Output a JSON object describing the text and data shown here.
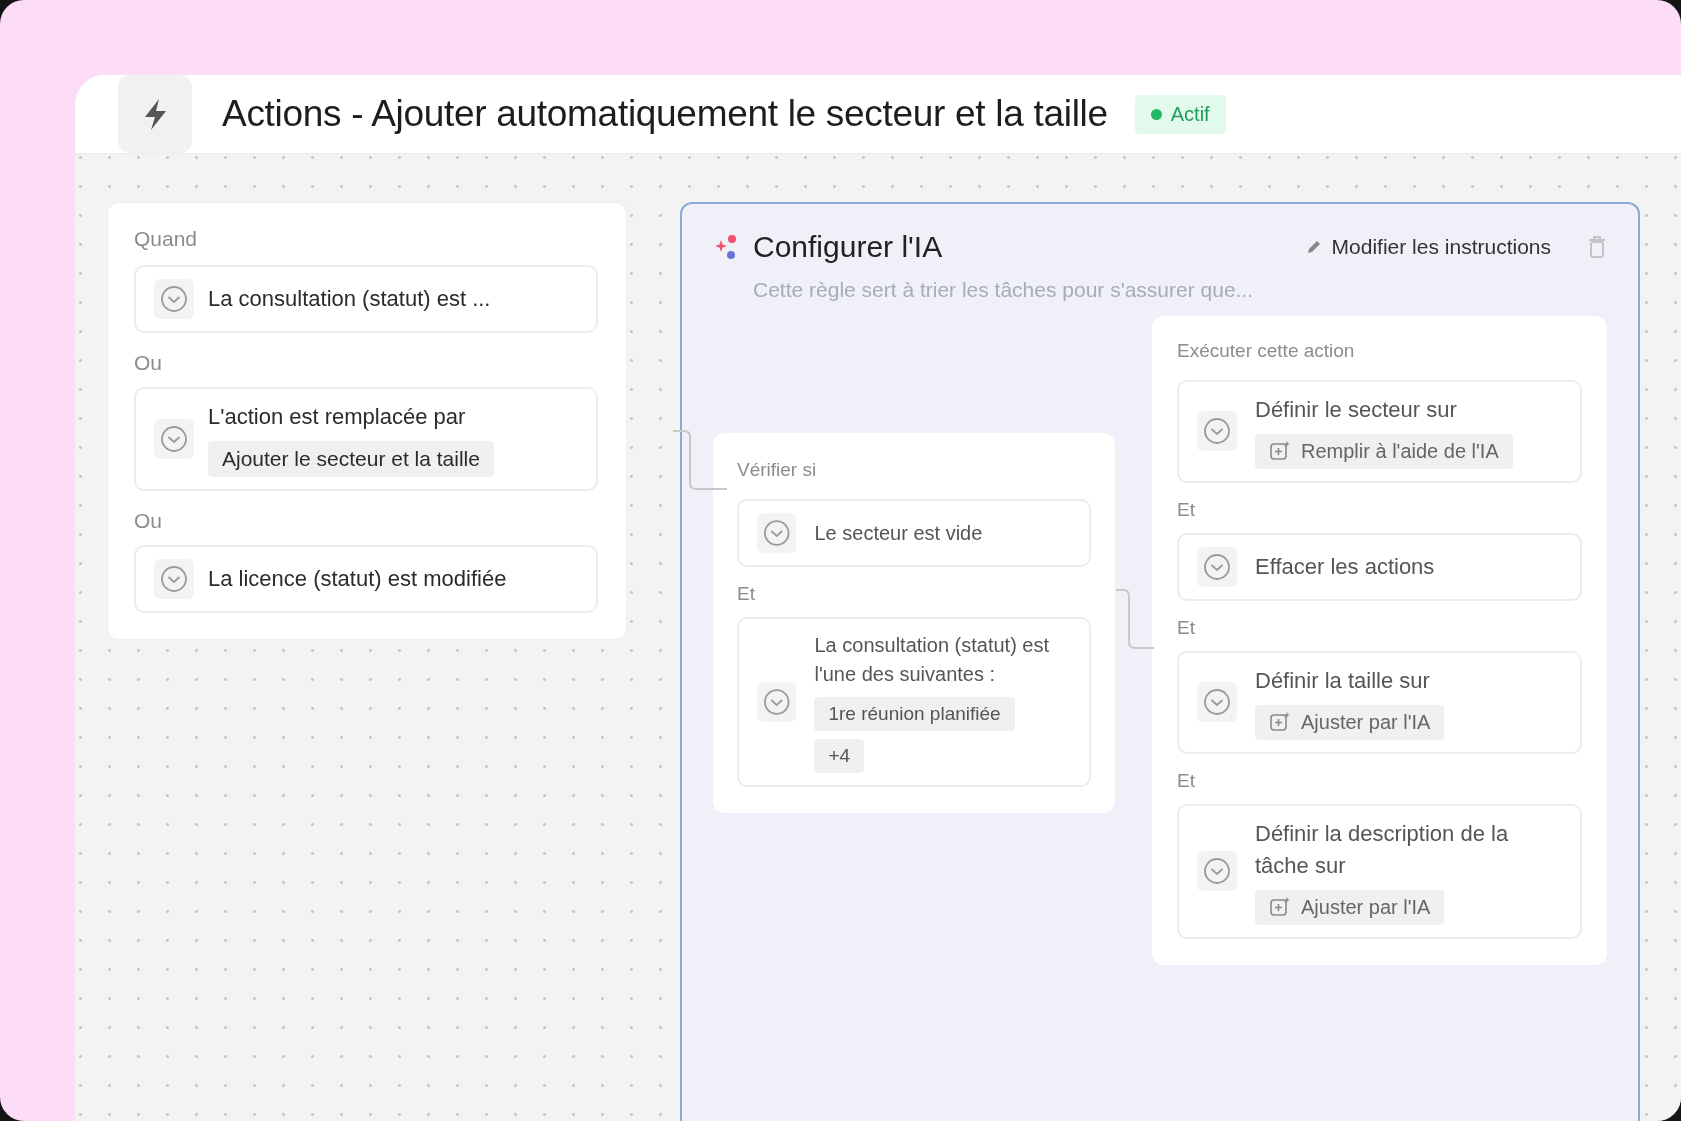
{
  "header": {
    "title": "Actions - Ajouter automatiquement le secteur et la taille",
    "status": {
      "label": "Actif",
      "active": true
    }
  },
  "trigger": {
    "label": "Quand",
    "conditions": [
      {
        "text": "La consultation (statut) est ..."
      },
      {
        "joiner": "Ou",
        "text": "L'action est remplacée par",
        "chips": [
          {
            "text": "Ajouter le secteur et la taille"
          }
        ]
      },
      {
        "joiner": "Ou",
        "text": "La licence (statut) est modifiée"
      }
    ]
  },
  "ai_panel": {
    "title": "Configurer l'IA",
    "edit_link": "Modifier les instructions",
    "description": "Cette règle sert à trier les tâches pour s'assurer que...",
    "check": {
      "label": "Vérifier si",
      "conditions": [
        {
          "text": "Le secteur est vide"
        },
        {
          "joiner": "Et",
          "text": "La consultation (statut) est l'une des suivantes :",
          "chips": [
            {
              "text": "1re réunion planifiée"
            },
            {
              "text": "+4"
            }
          ]
        }
      ]
    },
    "actions": {
      "label": "Exécuter cette action",
      "items": [
        {
          "text": "Définir le secteur sur",
          "chips": [
            {
              "text": "Remplir à l'aide de l'IA",
              "ai": true
            }
          ]
        },
        {
          "joiner": "Et",
          "text": "Effacer les actions"
        },
        {
          "joiner": "Et",
          "text": "Définir la taille sur",
          "chips": [
            {
              "text": "Ajuster par l'IA",
              "ai": true
            }
          ]
        },
        {
          "joiner": "Et",
          "text": "Définir la description de la tâche sur",
          "chips": [
            {
              "text": "Ajuster par l'IA",
              "ai": true
            }
          ]
        }
      ]
    }
  }
}
